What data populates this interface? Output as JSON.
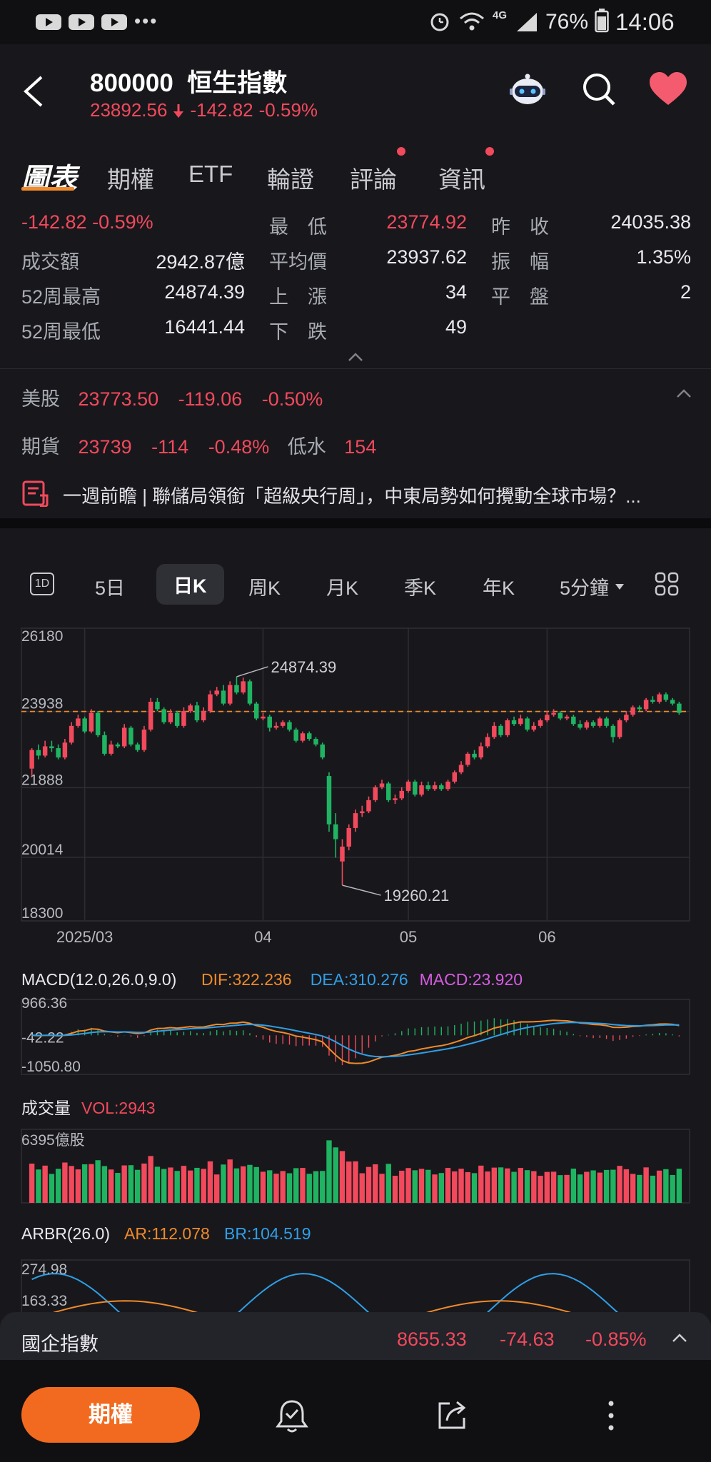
{
  "status_bar": {
    "battery": "76%",
    "time": "14:06",
    "network": "4G"
  },
  "header": {
    "code": "800000",
    "name": "恒生指數",
    "price": "23892.56",
    "change": "-142.82",
    "change_pct": "-0.59%"
  },
  "tabs": [
    {
      "label": "圖表",
      "active": true,
      "dot": false
    },
    {
      "label": "期權",
      "active": false,
      "dot": false
    },
    {
      "label": "ETF",
      "active": false,
      "dot": false
    },
    {
      "label": "輪證",
      "active": false,
      "dot": false
    },
    {
      "label": "評論",
      "active": false,
      "dot": true
    },
    {
      "label": "資訊",
      "active": false,
      "dot": true
    }
  ],
  "quote": {
    "change_text": "-142.82 -0.59%",
    "rows": [
      {
        "l1": "成交額",
        "v1": "2942.87億",
        "l2": "平均價",
        "v2": "23937.62",
        "l3": "振　幅",
        "v3": "1.35%"
      },
      {
        "l1": "52周最高",
        "v1": "24874.39",
        "l2": "上　漲",
        "v2": "34",
        "l3": "平　盤",
        "v3": "2"
      },
      {
        "l1": "52周最低",
        "v1": "16441.44",
        "l2": "下　跌",
        "v2": "49",
        "l3": "",
        "v3": ""
      }
    ],
    "low_label": "最　低",
    "low_value": "23774.92",
    "prev_label": "昨　收",
    "prev_value": "24035.38"
  },
  "us_stock": {
    "label": "美股",
    "price": "23773.50",
    "change": "-119.06",
    "pct": "-0.50%"
  },
  "futures": {
    "label": "期貨",
    "price": "23739",
    "change": "-114",
    "pct": "-0.48%",
    "basis_label": "低水",
    "basis": "154"
  },
  "news": {
    "text": "一週前瞻 | 聯儲局領銜「超級央行周」，中東局勢如何攪動全球市場？..."
  },
  "periods": [
    "1D",
    "5日",
    "日K",
    "周K",
    "月K",
    "季K",
    "年K",
    "5分鐘"
  ],
  "colors": {
    "up": "#f2495c",
    "down": "#1fb362",
    "dif": "#f08a2a",
    "dea": "#2f9fe8",
    "macd": "#d65ce0"
  },
  "chart_data": [
    {
      "type": "candlestick",
      "y_ticks": [
        "26180",
        "23938",
        "21888",
        "20014",
        "18300"
      ],
      "ylim": [
        18300,
        26180
      ],
      "x_ticks": [
        "2025/03",
        "04",
        "05",
        "06"
      ],
      "reference_line": 23938,
      "annotations": [
        {
          "label": "24874.39",
          "value": 24874.39
        },
        {
          "label": "19260.21",
          "value": 19260.21
        }
      ],
      "candles": [
        [
          22400,
          22900,
          22200,
          22950
        ],
        [
          22900,
          22750,
          22650,
          23050
        ],
        [
          22750,
          23000,
          22700,
          23150
        ],
        [
          23000,
          22950,
          22850,
          23150
        ],
        [
          22950,
          22700,
          22650,
          23050
        ],
        [
          22700,
          23100,
          22650,
          23200
        ],
        [
          23100,
          23550,
          23050,
          23650
        ],
        [
          23550,
          23750,
          23500,
          23850
        ],
        [
          23750,
          23400,
          23350,
          23800
        ],
        [
          23400,
          23900,
          23350,
          24000
        ],
        [
          23900,
          23300,
          23250,
          23950
        ],
        [
          23300,
          22800,
          22750,
          23400
        ],
        [
          22800,
          23050,
          22750,
          23150
        ],
        [
          23050,
          23000,
          22950,
          23100
        ],
        [
          23000,
          23500,
          22950,
          23600
        ],
        [
          23500,
          23050,
          23000,
          23550
        ],
        [
          23050,
          22900,
          22850,
          23100
        ],
        [
          22900,
          23450,
          22850,
          23550
        ],
        [
          23450,
          24200,
          23400,
          24300
        ],
        [
          24200,
          24000,
          23950,
          24300
        ],
        [
          24000,
          23650,
          23600,
          24050
        ],
        [
          23650,
          23900,
          23600,
          24000
        ],
        [
          23900,
          23550,
          23500,
          23950
        ],
        [
          23550,
          23950,
          23500,
          24050
        ],
        [
          23950,
          24100,
          23900,
          24150
        ],
        [
          24100,
          23700,
          23650,
          24200
        ],
        [
          23700,
          23950,
          23650,
          24050
        ],
        [
          23950,
          24400,
          23900,
          24500
        ],
        [
          24400,
          24500,
          24350,
          24600
        ],
        [
          24500,
          24150,
          24100,
          24650
        ],
        [
          24150,
          24650,
          24100,
          24750
        ],
        [
          24650,
          24450,
          24400,
          24874
        ],
        [
          24450,
          24750,
          24400,
          24850
        ],
        [
          24750,
          24150,
          24100,
          24800
        ],
        [
          24150,
          23750,
          23700,
          24200
        ],
        [
          23750,
          23800,
          23700,
          23900
        ],
        [
          23800,
          23500,
          23400,
          23850
        ],
        [
          23500,
          23550,
          23450,
          23650
        ],
        [
          23550,
          23650,
          23500,
          23700
        ],
        [
          23650,
          23450,
          23400,
          23700
        ],
        [
          23450,
          23150,
          23100,
          23500
        ],
        [
          23150,
          23350,
          23100,
          23400
        ],
        [
          23350,
          23200,
          23150,
          23400
        ],
        [
          23200,
          23050,
          23000,
          23250
        ],
        [
          23050,
          22700,
          22650,
          23100
        ],
        [
          22200,
          20900,
          20700,
          22300
        ],
        [
          20900,
          20500,
          20000,
          21200
        ],
        [
          19900,
          20300,
          19260,
          20500
        ],
        [
          20300,
          20800,
          20200,
          20900
        ],
        [
          20800,
          21200,
          20700,
          21300
        ],
        [
          21200,
          21250,
          21100,
          21400
        ],
        [
          21250,
          21550,
          21200,
          21650
        ],
        [
          21550,
          21900,
          21500,
          21950
        ],
        [
          21900,
          22000,
          21850,
          22100
        ],
        [
          22000,
          21550,
          21500,
          22050
        ],
        [
          21550,
          21600,
          21450,
          21700
        ],
        [
          21600,
          21800,
          21550,
          21900
        ],
        [
          21800,
          22050,
          21750,
          22100
        ],
        [
          22050,
          21700,
          21650,
          22100
        ],
        [
          21700,
          21950,
          21650,
          22050
        ],
        [
          21950,
          21850,
          21800,
          22050
        ],
        [
          21850,
          21950,
          21800,
          22050
        ],
        [
          21950,
          21850,
          21800,
          22000
        ],
        [
          21850,
          22050,
          21800,
          22100
        ],
        [
          22050,
          22300,
          22000,
          22350
        ],
        [
          22300,
          22500,
          22250,
          22600
        ],
        [
          22500,
          22800,
          22450,
          22850
        ],
        [
          22800,
          22700,
          22650,
          22900
        ],
        [
          22700,
          23000,
          22650,
          23100
        ],
        [
          23000,
          23250,
          22950,
          23350
        ],
        [
          23250,
          23550,
          23200,
          23650
        ],
        [
          23550,
          23300,
          23250,
          23600
        ],
        [
          23300,
          23700,
          23250,
          23750
        ],
        [
          23700,
          23600,
          23550,
          23800
        ],
        [
          23600,
          23750,
          23550,
          23850
        ],
        [
          23750,
          23450,
          23400,
          23800
        ],
        [
          23450,
          23550,
          23400,
          23650
        ],
        [
          23550,
          23700,
          23500,
          23750
        ],
        [
          23700,
          23850,
          23650,
          23950
        ],
        [
          23850,
          23900,
          23800,
          24000
        ],
        [
          23900,
          23750,
          23700,
          23950
        ],
        [
          23750,
          23800,
          23700,
          23850
        ],
        [
          23800,
          23600,
          23550,
          23850
        ],
        [
          23600,
          23500,
          23450,
          23700
        ],
        [
          23500,
          23650,
          23450,
          23700
        ],
        [
          23650,
          23550,
          23500,
          23700
        ],
        [
          23550,
          23750,
          23500,
          23800
        ],
        [
          23750,
          23550,
          23500,
          23800
        ],
        [
          23550,
          23250,
          23100,
          23600
        ],
        [
          23250,
          23700,
          23200,
          23750
        ],
        [
          23700,
          23850,
          23650,
          23950
        ],
        [
          23850,
          24050,
          23800,
          24100
        ],
        [
          24050,
          24000,
          23950,
          24100
        ],
        [
          24000,
          24250,
          23950,
          24300
        ],
        [
          24250,
          24200,
          24150,
          24350
        ],
        [
          24200,
          24400,
          24150,
          24450
        ],
        [
          24400,
          24250,
          24200,
          24450
        ],
        [
          24250,
          24150,
          24100,
          24300
        ],
        [
          24150,
          23900,
          23850,
          24200
        ]
      ]
    },
    {
      "type": "line",
      "name": "MACD",
      "title": "MACD(12.0,26.0,9.0)",
      "legend": [
        {
          "label": "DIF:322.236",
          "color": "#f08a2a"
        },
        {
          "label": "DEA:310.276",
          "color": "#2f9fe8"
        },
        {
          "label": "MACD:23.920",
          "color": "#d65ce0"
        }
      ],
      "y_ticks": [
        "966.36",
        "-42.22",
        "-1050.80"
      ],
      "ylim": [
        -1050.8,
        966.36
      ]
    },
    {
      "type": "bar",
      "name": "VOL",
      "title": "成交量",
      "legend": [
        {
          "label": "VOL:2943",
          "color": "#f2495c"
        }
      ],
      "y_ticks": [
        "6395億股"
      ],
      "ymax": 6395
    },
    {
      "type": "line",
      "name": "ARBR",
      "title": "ARBR(26.0)",
      "legend": [
        {
          "label": "AR:112.078",
          "color": "#f08a2a"
        },
        {
          "label": "BR:104.519",
          "color": "#2f9fe8"
        }
      ],
      "y_ticks": [
        "274.98",
        "163.33"
      ]
    }
  ],
  "index_bar": {
    "name": "國企指數",
    "price": "8655.33",
    "change": "-74.63",
    "pct": "-0.85%"
  },
  "bottom": {
    "options_button": "期權"
  }
}
